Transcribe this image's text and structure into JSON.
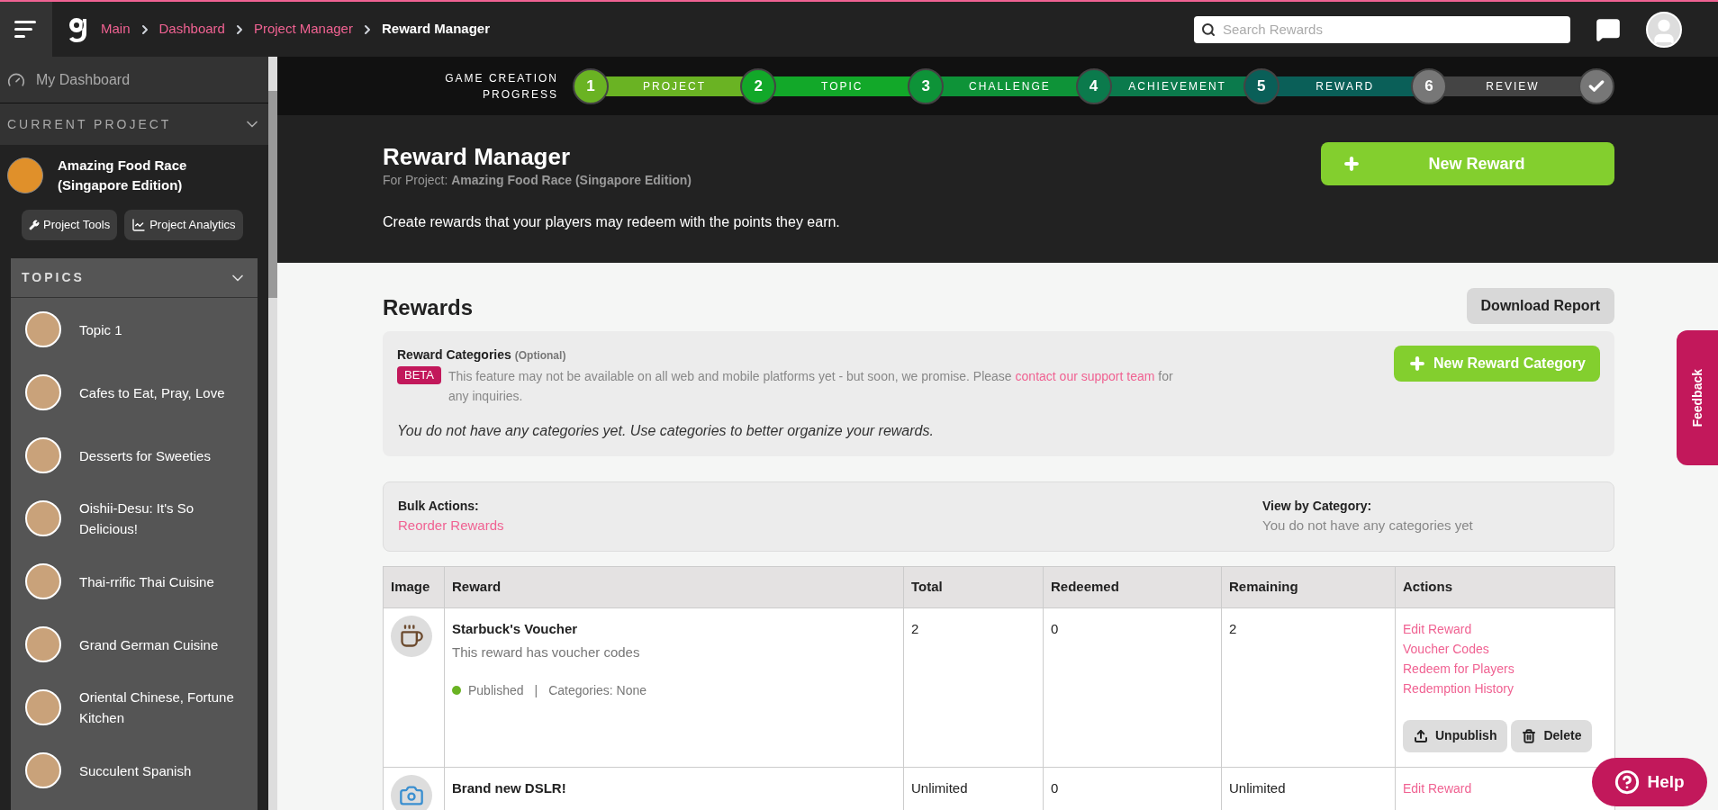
{
  "topbar": {
    "breadcrumbs": [
      {
        "label": "Main",
        "current": false
      },
      {
        "label": "Dashboard",
        "current": false
      },
      {
        "label": "Project Manager",
        "current": false
      },
      {
        "label": "Reward Manager",
        "current": true
      }
    ],
    "search": {
      "placeholder": "Search Rewards"
    }
  },
  "sidebar": {
    "dashboard_link": "My Dashboard",
    "current_project": {
      "heading": "CURRENT PROJECT",
      "expanded": true,
      "name": "Amazing Food Race (Singapore Edition)",
      "buttons": [
        {
          "label": "Project Tools",
          "kind": "tools"
        },
        {
          "label": "Project Analytics",
          "kind": "analytics"
        }
      ]
    },
    "topics": {
      "heading": "TOPICS",
      "expanded": true,
      "items": [
        {
          "label": "Topic 1"
        },
        {
          "label": "Cafes to Eat, Pray, Love"
        },
        {
          "label": "Desserts for Sweeties"
        },
        {
          "label": "Oishii-Desu: It's So Delicious!"
        },
        {
          "label": "Thai-rrific Thai Cuisine"
        },
        {
          "label": "Grand German Cuisine"
        },
        {
          "label": "Oriental Chinese, Fortune Kitchen"
        },
        {
          "label": "Succulent Spanish"
        }
      ]
    }
  },
  "progress": {
    "title": "GAME CREATION PROGRESS",
    "steps": [
      {
        "number": "1",
        "label": "PROJECT",
        "color": "#6ab323"
      },
      {
        "number": "2",
        "label": "TOPIC",
        "color": "#12a829"
      },
      {
        "number": "3",
        "label": "CHALLENGE",
        "color": "#0e9338"
      },
      {
        "number": "4",
        "label": "ACHIEVEMENT",
        "color": "#0b7a4c"
      },
      {
        "number": "5",
        "label": "REWARD",
        "color": "#0a5f58"
      },
      {
        "number": "6",
        "label": "REVIEW",
        "color": "#444444"
      }
    ]
  },
  "header": {
    "title": "Reward Manager",
    "project_prefix": "For Project:",
    "project_name": "Amazing Food Race (Singapore Edition)",
    "description": "Create rewards that your players may redeem with the points they earn.",
    "new_button": "New Reward"
  },
  "rewards": {
    "title": "Rewards",
    "download_button": "Download Report",
    "categories": {
      "title": "Reward Categories",
      "optional": "(Optional)",
      "badge": "BETA",
      "notice": "This feature may not be available on all web and mobile platforms yet - but soon, we promise. Please",
      "link": "contact our support team",
      "notice_end": "for any inquiries.",
      "empty": "You do not have any categories yet. Use categories to better organize your rewards.",
      "new_button": "New Reward Category"
    },
    "bulk": {
      "label": "Bulk Actions:",
      "link": "Reorder Rewards",
      "view_label": "View by Category:",
      "view_value": "You do not have any categories yet"
    },
    "table": {
      "columns": [
        "Image",
        "Reward",
        "Total",
        "Redeemed",
        "Remaining",
        "Actions"
      ],
      "rows": [
        {
          "name": "Starbuck's Voucher",
          "description": "This reward has voucher codes",
          "status": {
            "label": "Published",
            "color": "#6ab323"
          },
          "separator": "|",
          "categories": "Categories: None",
          "total": "2",
          "redeemed": "0",
          "remaining": "2",
          "links": [
            "Edit Reward",
            "Voucher Codes",
            "Redeem for Players",
            "Redemption History"
          ],
          "buttons": [
            {
              "label": "Unpublish",
              "kind": "unpublish"
            },
            {
              "label": "Delete",
              "kind": "delete"
            }
          ]
        },
        {
          "name": "Brand new DSLR!",
          "total": "Unlimited",
          "redeemed": "0",
          "remaining": "Unlimited",
          "links": [
            "Edit Reward"
          ]
        }
      ]
    }
  },
  "feedback": "Feedback",
  "help": "Help"
}
